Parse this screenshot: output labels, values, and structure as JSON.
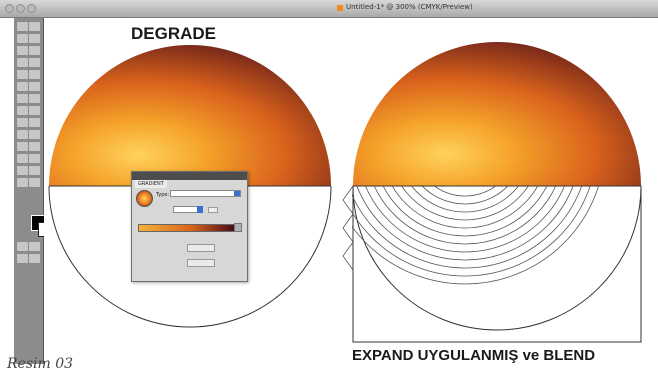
{
  "window": {
    "title": "Untitled-1* @ 300% (CMYK/Preview)"
  },
  "headings": {
    "degrade": "DEGRADE",
    "expand_blend": "EXPAND UYGULANMIŞ ve BLEND"
  },
  "caption": "Resim 03",
  "gradient_panel": {
    "tab": "GRADIENT",
    "type_label": "Type:"
  },
  "colors": {
    "gradient_light": "#ffd25c",
    "gradient_mid": "#e8781d",
    "gradient_dark": "#4a0d18"
  }
}
